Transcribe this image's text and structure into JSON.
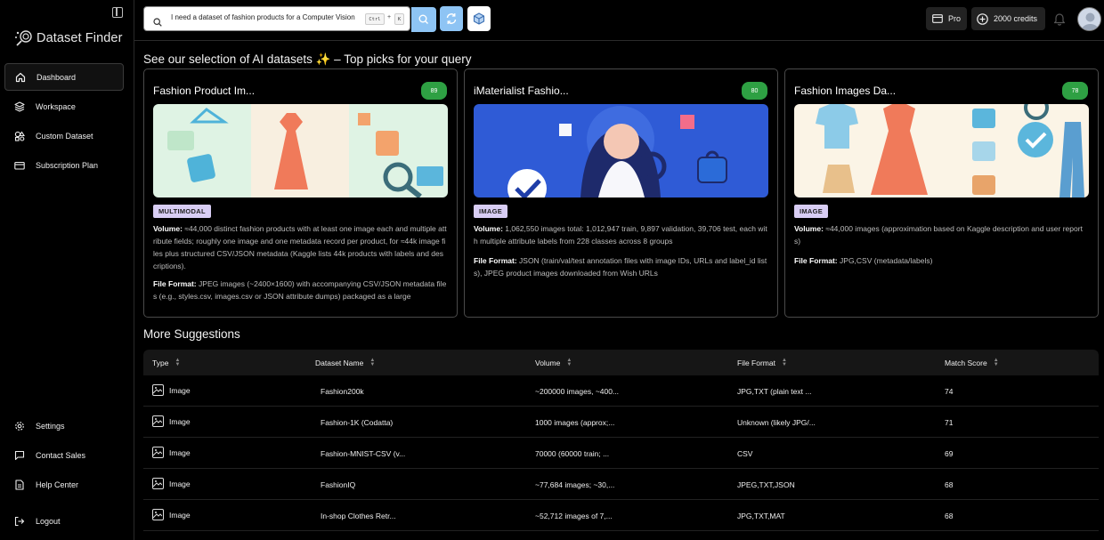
{
  "app": {
    "title": "Dataset Finder"
  },
  "sidebar": {
    "items": [
      {
        "label": "Dashboard",
        "icon": "home-icon",
        "active": true
      },
      {
        "label": "Workspace",
        "icon": "layers-icon"
      },
      {
        "label": "Custom Dataset",
        "icon": "shapes-icon"
      },
      {
        "label": "Subscription Plan",
        "icon": "credit-card-icon"
      }
    ],
    "bottom_items": [
      {
        "label": "Settings",
        "icon": "gear-icon"
      },
      {
        "label": "Contact Sales",
        "icon": "chat-icon"
      },
      {
        "label": "Help Center",
        "icon": "document-icon"
      },
      {
        "label": "Logout",
        "icon": "logout-icon"
      }
    ]
  },
  "search": {
    "value": "I need a dataset of fashion products for a Computer Vision",
    "kbd_ctrl": "Ctrl",
    "kbd_plus": "+",
    "kbd_key": "K"
  },
  "header": {
    "pro_label": "Pro",
    "credits_label": "2000 credits"
  },
  "main": {
    "section_title": "See our selection of AI datasets ✨ – Top picks for your query",
    "more_title": "More Suggestions",
    "cards": [
      {
        "title": "Fashion Product Im...",
        "score": "89",
        "badge": "MULTIMODAL",
        "volume_label": "Volume:",
        "volume": "≈44,000 distinct fashion products with at least one image each and multiple attribute fields; roughly one image and one metadata record per product, for ≈44k image files plus structured CSV/JSON metadata (Kaggle lists 44k products with labels and descriptions).",
        "format_label": "File Format:",
        "format": "JPEG images (~2400×1600) with accompanying CSV/JSON metadata files (e.g., styles.csv, images.csv or JSON attribute dumps) packaged as a large"
      },
      {
        "title": "iMaterialist Fashio...",
        "score": "80",
        "badge": "IMAGE",
        "volume_label": "Volume:",
        "volume": "1,062,550 images total: 1,012,947 train, 9,897 validation, 39,706 test, each with multiple attribute labels from 228 classes across 8 groups",
        "format_label": "File Format:",
        "format": "JSON (train/val/test annotation files with image IDs, URLs and label_id lists), JPEG product images downloaded from Wish URLs"
      },
      {
        "title": "Fashion Images Da...",
        "score": "78",
        "badge": "IMAGE",
        "volume_label": "Volume:",
        "volume": "≈44,000 images (approximation based on Kaggle description and user reports)",
        "format_label": "File Format:",
        "format": "JPG,CSV (metadata/labels)"
      }
    ],
    "table": {
      "headers": [
        "Type",
        "Dataset Name",
        "Volume",
        "File Format",
        "Match Score"
      ],
      "rows": [
        {
          "type": "Image",
          "name": "Fashion200k",
          "volume": "~200000 images, ~400...",
          "format": "JPG,TXT (plain text ...",
          "score": "74"
        },
        {
          "type": "Image",
          "name": "Fashion-1K (Codatta)",
          "volume": "1000 images (approx;...",
          "format": "Unknown (likely JPG/...",
          "score": "71"
        },
        {
          "type": "Image",
          "name": "Fashion-MNIST-CSV (v...",
          "volume": "70000 (60000 train; ...",
          "format": "CSV",
          "score": "69"
        },
        {
          "type": "Image",
          "name": "FashionIQ",
          "volume": "~77,684 images; ~30,...",
          "format": "JPEG,TXT,JSON",
          "score": "68"
        },
        {
          "type": "Image",
          "name": "In-shop Clothes Retr...",
          "volume": "~52,712 images of 7,...",
          "format": "JPG,TXT,MAT",
          "score": "68"
        }
      ]
    }
  },
  "colors": {
    "score_green": "#2ea043",
    "accent_blue": "#8ec4f4",
    "badge_lavender": "#d8cdf4"
  }
}
